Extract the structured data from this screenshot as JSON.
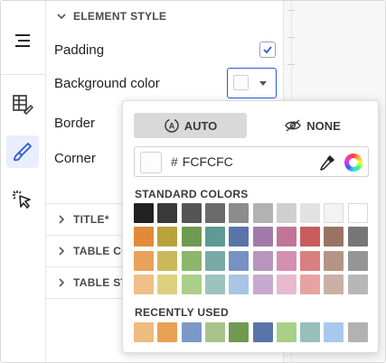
{
  "panel": {
    "sections": {
      "element_style": "ELEMENT STYLE",
      "title": "TITLE*",
      "table_columns": "TABLE CO",
      "table_style": "TABLE STY"
    },
    "rows": {
      "padding": "Padding",
      "background_color": "Background color",
      "border": "Border",
      "corner": "Corner"
    },
    "padding_checked": true,
    "background_value": "#FCFCFC"
  },
  "rail": {
    "icons": [
      "menu-icon",
      "format-table-icon",
      "style-brush-icon",
      "interact-cursor-icon"
    ],
    "active": "style-brush-icon",
    "accent": "#2d5bd3"
  },
  "popover": {
    "mode_auto_label": "AUTO",
    "mode_none_label": "NONE",
    "selected_mode": "AUTO",
    "hash": "#",
    "hex_value": "FCFCFC",
    "standard_title": "STANDARD COLORS",
    "recent_title": "RECENTLY USED",
    "standard_colors": [
      [
        "#222222",
        "#3a3a3a",
        "#555555",
        "#6b6b6b",
        "#8c8c8c",
        "#b2b2b2",
        "#cfcfcf",
        "#e2e2e2",
        "#f3f3f3",
        "#ffffff"
      ],
      [
        "#e08b3a",
        "#b8a23a",
        "#6f9a52",
        "#5e9a94",
        "#5a74aa",
        "#a27aa9",
        "#c17596",
        "#c95b5b",
        "#9a7462",
        "#767676"
      ],
      [
        "#e7a25c",
        "#cbb85c",
        "#8db56b",
        "#79aba6",
        "#7891c2",
        "#b995bd",
        "#d58fb0",
        "#d88080",
        "#b49484",
        "#959595"
      ],
      [
        "#eebf86",
        "#ddd07e",
        "#a9cf8a",
        "#9cc3bd",
        "#a9c4e5",
        "#c8a9cf",
        "#e9b8cc",
        "#e9a2a2",
        "#cbb0a5",
        "#b7b7b7"
      ]
    ],
    "recent_colors": [
      "#edbc7f",
      "#e8a055",
      "#7b98c6",
      "#a7c48b",
      "#6f9a52",
      "#5a74aa",
      "#a9cf8a",
      "#96c1bb",
      "#a9c8ee",
      "#b2b2b2"
    ]
  }
}
